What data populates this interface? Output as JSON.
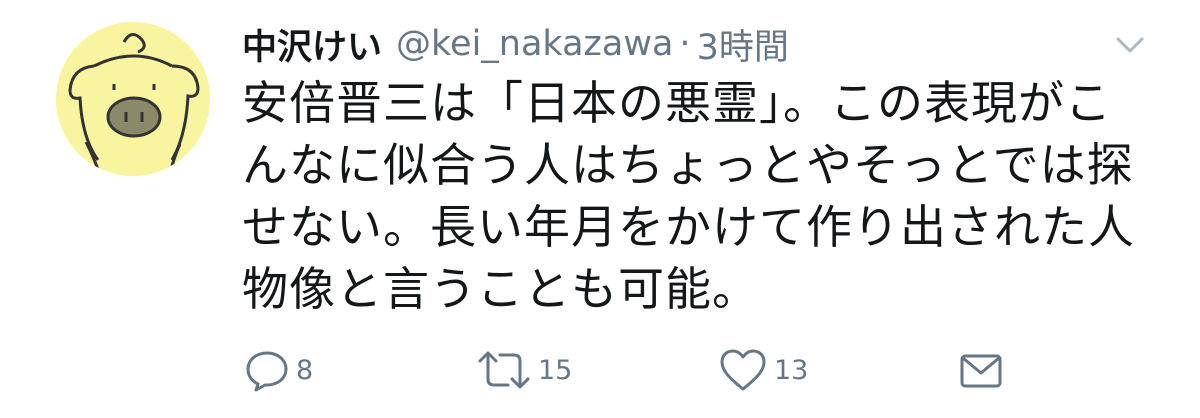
{
  "tweet": {
    "display_name": "中沢けい",
    "handle": "@kei_nakazawa",
    "separator": "·",
    "time": "3時間",
    "text": "安倍晋三は「日本の悪霊」。この表現がこんなに似合う人はちょっとやそっとでは探せない。長い年月をかけて作り出された人物像と言うことも可能。"
  },
  "actions": {
    "reply_count": "8",
    "retweet_count": "15",
    "like_count": "13"
  },
  "colors": {
    "avatar_bg": "#f8f4a0",
    "secondary_text": "#657786",
    "primary_text": "#14171a"
  },
  "icons": {
    "avatar": "pig-avatar",
    "menu": "chevron-down-icon",
    "reply": "reply-icon",
    "retweet": "retweet-icon",
    "like": "heart-icon",
    "message": "envelope-icon"
  }
}
